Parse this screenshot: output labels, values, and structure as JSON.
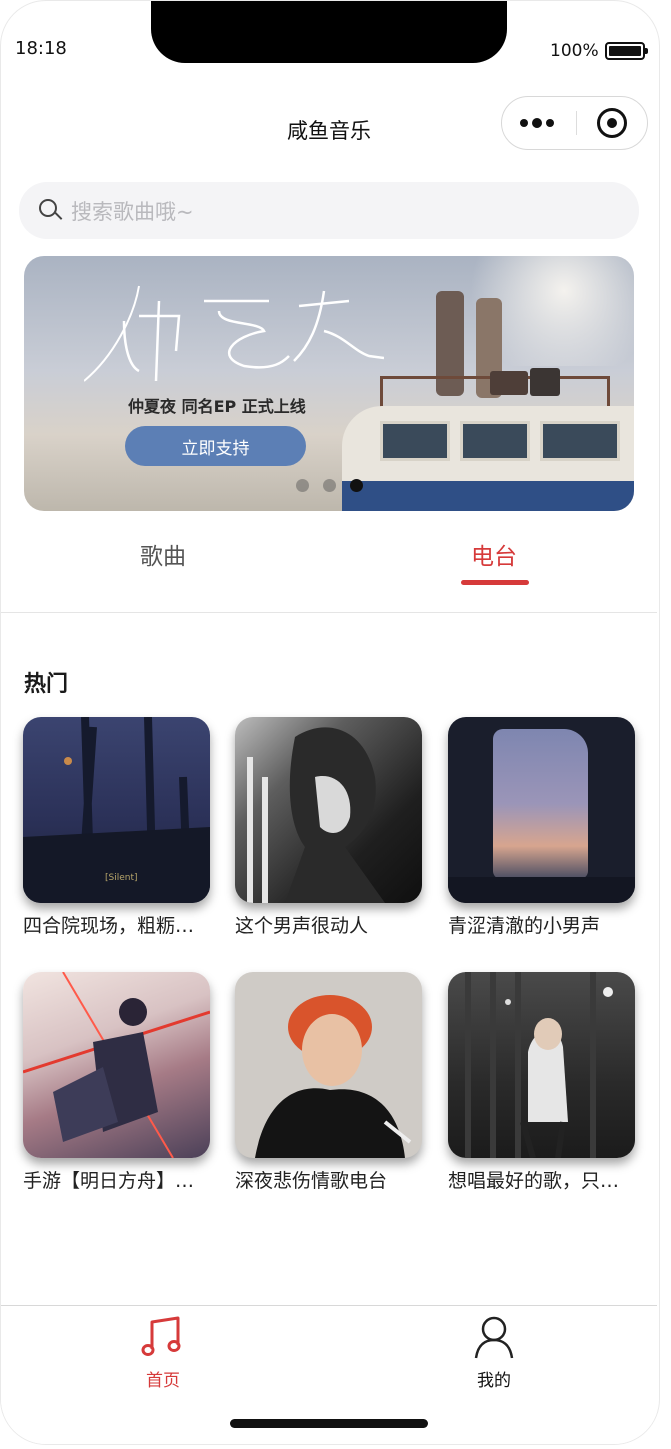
{
  "status_bar": {
    "time": "18:18",
    "battery": "100%"
  },
  "header": {
    "title": "咸鱼音乐"
  },
  "search": {
    "placeholder": "搜索歌曲哦~"
  },
  "banner": {
    "calligraphy": "仲夏夜",
    "subtitle": "仲夏夜 同名EP 正式上线",
    "button_label": "立即支持",
    "slide_count": 3,
    "active_slide": 3
  },
  "tabs": [
    {
      "label": "歌曲",
      "active": false
    },
    {
      "label": "电台",
      "active": true
    }
  ],
  "section": {
    "title": "热门"
  },
  "stations": [
    {
      "caption": "四合院现场，粗粝的温柔",
      "cover_text": "[Silent]"
    },
    {
      "caption": "这个男声很动人"
    },
    {
      "caption": "青涩清澈的小男声"
    },
    {
      "caption": "手游【明日方舟】原声"
    },
    {
      "caption": "深夜悲伤情歌电台"
    },
    {
      "caption": "想唱最好的歌，只唱给你听"
    }
  ],
  "nav": {
    "home_label": "首页",
    "mine_label": "我的",
    "accent": "#d63a3a"
  }
}
